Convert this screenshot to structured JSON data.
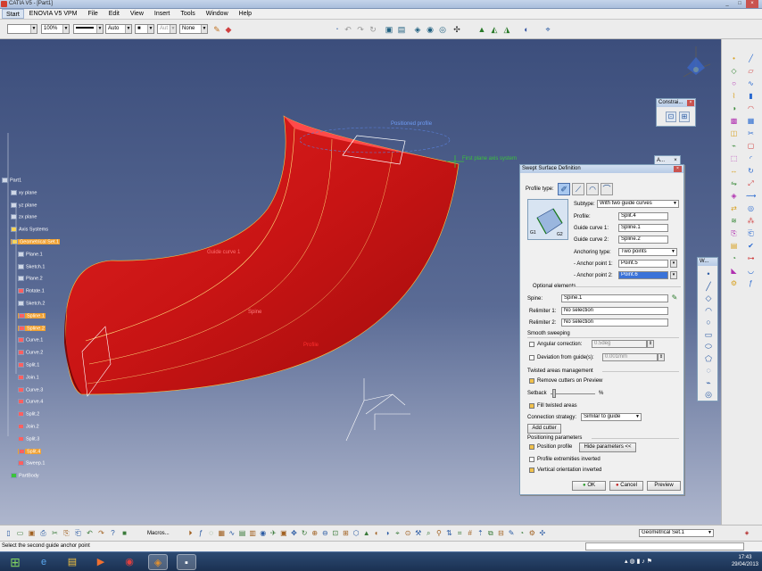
{
  "window": {
    "title": "CATIA V5 - [Part1]"
  },
  "menu": [
    "Start",
    "ENOVIA V5 VPM",
    "File",
    "Edit",
    "View",
    "Insert",
    "Tools",
    "Window",
    "Help"
  ],
  "toolbar": {
    "zoom": "100%",
    "line_type": "Auto",
    "font": "Aut",
    "layer": "None"
  },
  "tree": [
    {
      "label": "Part1",
      "type": "root"
    },
    {
      "label": "xy plane",
      "type": "plane"
    },
    {
      "label": "yz plane",
      "type": "plane"
    },
    {
      "label": "zx plane",
      "type": "plane"
    },
    {
      "label": "Axis Systems",
      "type": "set"
    },
    {
      "label": "Geometrical Set.1",
      "type": "set",
      "selected": true
    },
    {
      "label": "Plane.1",
      "type": "plane"
    },
    {
      "label": "Sketch.1",
      "type": "sketch"
    },
    {
      "label": "Plane.2",
      "type": "plane"
    },
    {
      "label": "Rotate.1",
      "type": "feat"
    },
    {
      "label": "Sketch.2",
      "type": "sketch"
    },
    {
      "label": "Spline.1",
      "type": "curve",
      "selected": true
    },
    {
      "label": "Spline.2",
      "type": "curve",
      "selected": true
    },
    {
      "label": "Curve.1",
      "type": "curve"
    },
    {
      "label": "Curve.2",
      "type": "curve"
    },
    {
      "label": "Split.1",
      "type": "feat"
    },
    {
      "label": "Join.1",
      "type": "feat"
    },
    {
      "label": "Curve.3",
      "type": "curve"
    },
    {
      "label": "Curve.4",
      "type": "curve"
    },
    {
      "label": "Split.2",
      "type": "feat"
    },
    {
      "label": "Join.2",
      "type": "feat"
    },
    {
      "label": "Split.3",
      "type": "feat"
    },
    {
      "label": "Split.4",
      "type": "feat",
      "selected": true
    },
    {
      "label": "Sweep.1",
      "type": "feat"
    },
    {
      "label": "PartBody",
      "type": "body"
    }
  ],
  "viewport_labels": {
    "positioned_profile": "Positioned profile",
    "first_plane_axis": "First plane axis system",
    "guide_curve": "Guide curve 1",
    "spine": "Spine",
    "profile": "Profile"
  },
  "constraint_panel": {
    "title": "Constrai..."
  },
  "small_panel": {
    "title": "A..."
  },
  "wtoolbar": {
    "title": "W..."
  },
  "dialog": {
    "title": "Swept Surface Definition",
    "profile_type_label": "Profile type:",
    "subtype_label": "Subtype:",
    "subtype_value": "With two guide curves",
    "profile_label": "Profile:",
    "profile_value": "Split.4",
    "guide1_label": "Guide curve 1:",
    "guide1_value": "Spline.1",
    "guide2_label": "Guide curve 2:",
    "guide2_value": "Spline.2",
    "anchoring_label": "Anchoring type:",
    "anchoring_value": "Two points",
    "anchor1_label": "- Anchor point 1:",
    "anchor1_value": "Point.5",
    "anchor2_label": "- Anchor point 2:",
    "anchor2_value": "Point.6",
    "optional_title": "Optional elements",
    "spine_label": "Spine:",
    "spine_value": "Spine.1",
    "relim1_label": "Relimiter 1:",
    "relim1_value": "No selection",
    "relim2_label": "Relimiter 2:",
    "relim2_value": "No selection",
    "smooth_title": "Smooth sweeping",
    "angular_label": "Angular correction:",
    "angular_value": "0.5deg",
    "deviation_label": "Deviation from guide(s):",
    "deviation_value": "0.001mm",
    "twisted_title": "Twisted areas management",
    "remove_cutters_label": "Remove cutters on Preview",
    "setback_label": "Setback",
    "setback_unit": "%",
    "fill_twisted_label": "Fill twisted areas",
    "connection_label": "Connection strategy:",
    "connection_value": "Similar to guide",
    "add_cutter": "Add cutter",
    "positioning_title": "Positioning parameters",
    "position_profile_label": "Position profile",
    "hide_params": "Hide parameters <<",
    "extremities_label": "Profile extremities inverted",
    "vertical_label": "Vertical orientation inverted",
    "ok": "OK",
    "cancel": "Cancel",
    "preview": "Preview",
    "g1": "G1",
    "g2": "G2"
  },
  "bottom_toolbar": {
    "macros": "Macros...",
    "geom_set": "Geometrical Set.1"
  },
  "status": "Select the second guide anchor point",
  "clock": {
    "time": "17:43",
    "date": "29/04/2013"
  }
}
